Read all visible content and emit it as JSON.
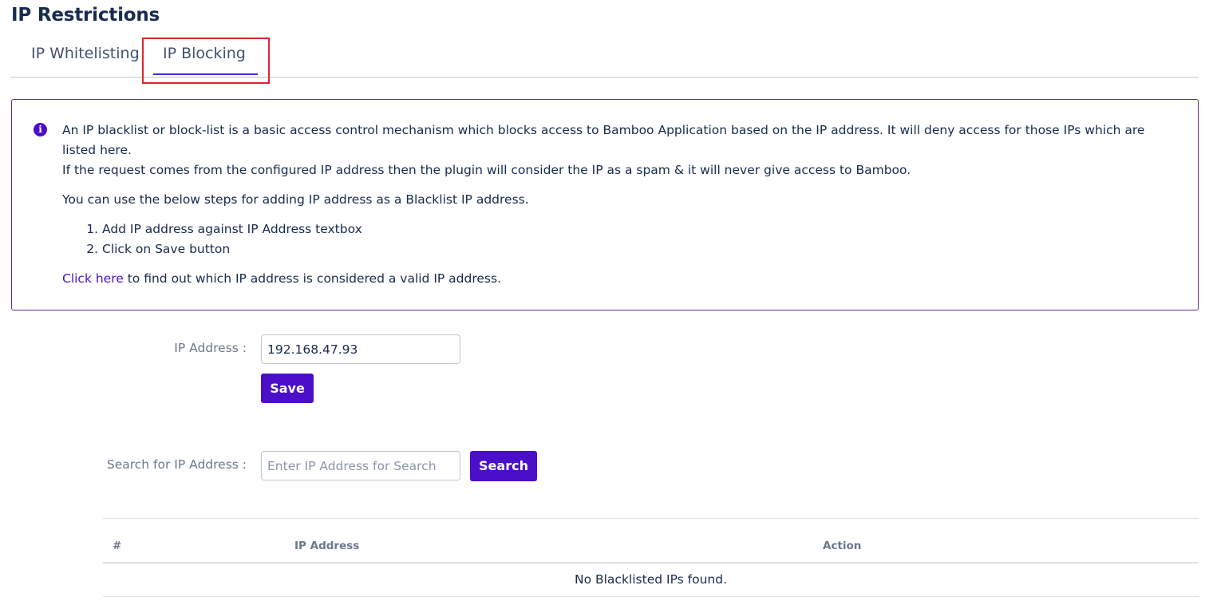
{
  "page": {
    "title": "IP Restrictions"
  },
  "tabs": [
    {
      "label": "IP Whitelisting",
      "active": false
    },
    {
      "label": "IP Blocking",
      "active": true
    }
  ],
  "info": {
    "line1": "An IP blacklist or block-list is a basic access control mechanism which blocks access to Bamboo Application based on the IP address. It will deny access for those IPs which are listed here.",
    "line2": "If the request comes from the configured IP address then the plugin will consider the IP as a spam & it will never give access to Bamboo.",
    "steps_intro": "You can use the below steps for adding IP address as a Blacklist IP address.",
    "steps": [
      "Add IP address against IP Address textbox",
      "Click on Save button"
    ],
    "link_text": "Click here",
    "link_suffix": " to find out which IP address is considered a valid IP address."
  },
  "ip_form": {
    "label": "IP Address :",
    "value": "192.168.47.93",
    "save_label": "Save"
  },
  "search_form": {
    "label": "Search for IP Address :",
    "placeholder": "Enter IP Address for Search",
    "button_label": "Search"
  },
  "table": {
    "columns": [
      "#",
      "IP Address",
      "Action"
    ],
    "empty_message": "No Blacklisted IPs found."
  },
  "colors": {
    "accent": "#4b0fc9",
    "highlight": "#d9272e",
    "panel_border": "#5e2a9c"
  }
}
